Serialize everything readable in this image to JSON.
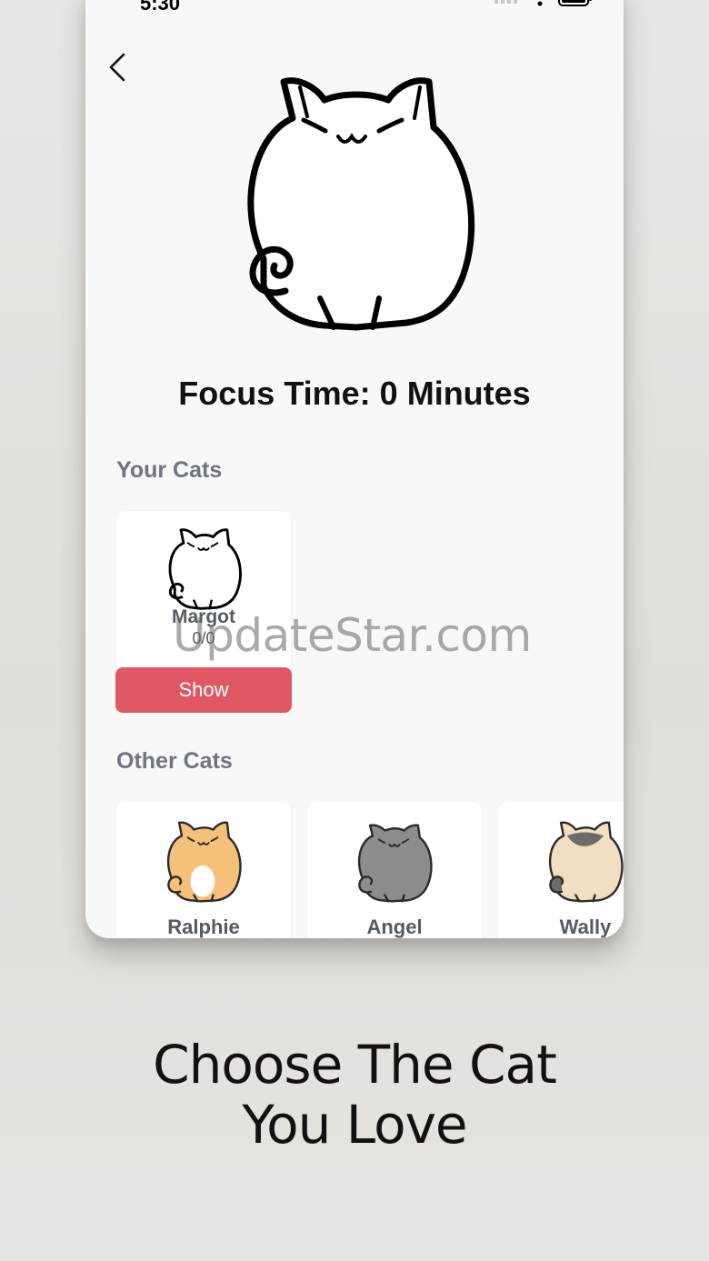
{
  "status_bar": {
    "time": "5:30"
  },
  "header": {
    "back_icon": "chevron-left-icon"
  },
  "focus": {
    "text": "Focus Time: 0 Minutes"
  },
  "your_cats": {
    "title": "Your Cats",
    "items": [
      {
        "name": "Margot",
        "progress": "0/0",
        "button": "Show",
        "color": "#ffffff"
      }
    ]
  },
  "other_cats": {
    "title": "Other Cats",
    "items": [
      {
        "name": "Ralphie",
        "color": "#f5c07a"
      },
      {
        "name": "Angel",
        "color": "#8c8c8c"
      },
      {
        "name": "Wally",
        "color": "#f3dfbf"
      }
    ]
  },
  "watermark": "UpdateStar.com",
  "tagline": {
    "line1": "Choose The Cat",
    "line2": "You Love"
  },
  "colors": {
    "button": "#e05864",
    "section_title": "#6f7481",
    "background": "#e4e1dd"
  }
}
